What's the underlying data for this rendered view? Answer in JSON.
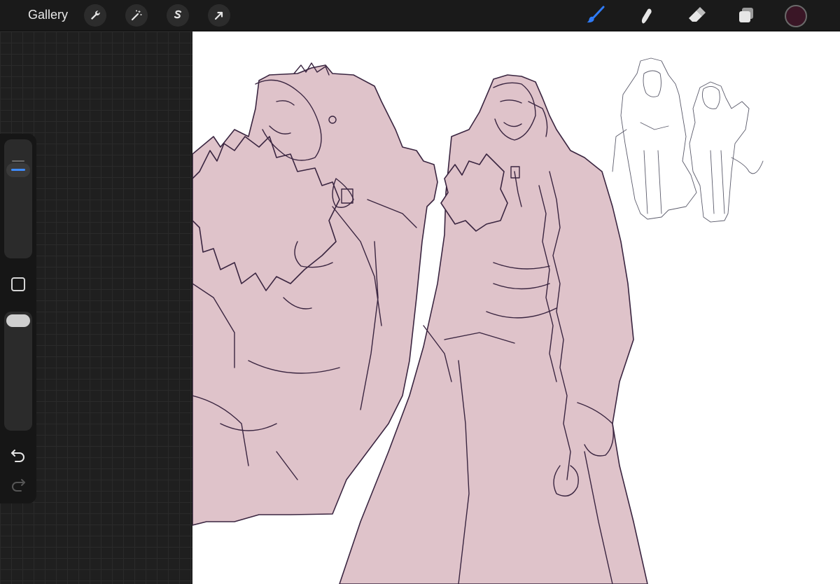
{
  "topbar": {
    "gallery_label": "Gallery",
    "left_tools": [
      {
        "icon": "wrench-icon",
        "name": "actions"
      },
      {
        "icon": "magic-wand-icon",
        "name": "adjustments"
      },
      {
        "icon": "selection-s-icon",
        "name": "selection"
      },
      {
        "icon": "arrow-cursor-icon",
        "name": "transform"
      }
    ],
    "right_tools": [
      {
        "icon": "brush-icon",
        "name": "paint",
        "active": true
      },
      {
        "icon": "smudge-icon",
        "name": "smudge"
      },
      {
        "icon": "eraser-icon",
        "name": "erase"
      },
      {
        "icon": "layers-icon",
        "name": "layers"
      }
    ],
    "current_color": "#3a1626",
    "active_color": "#2f7bf6"
  },
  "sidebar": {
    "brush_size_icon": "size-slider",
    "modify_icon": "square-icon",
    "opacity_icon": "opacity-slider",
    "undo_icon": "undo-icon",
    "redo_icon": "redo-icon"
  },
  "canvas": {
    "fill_color": "#dfc3ca",
    "line_color": "#3a2540",
    "background": "#ffffff"
  }
}
